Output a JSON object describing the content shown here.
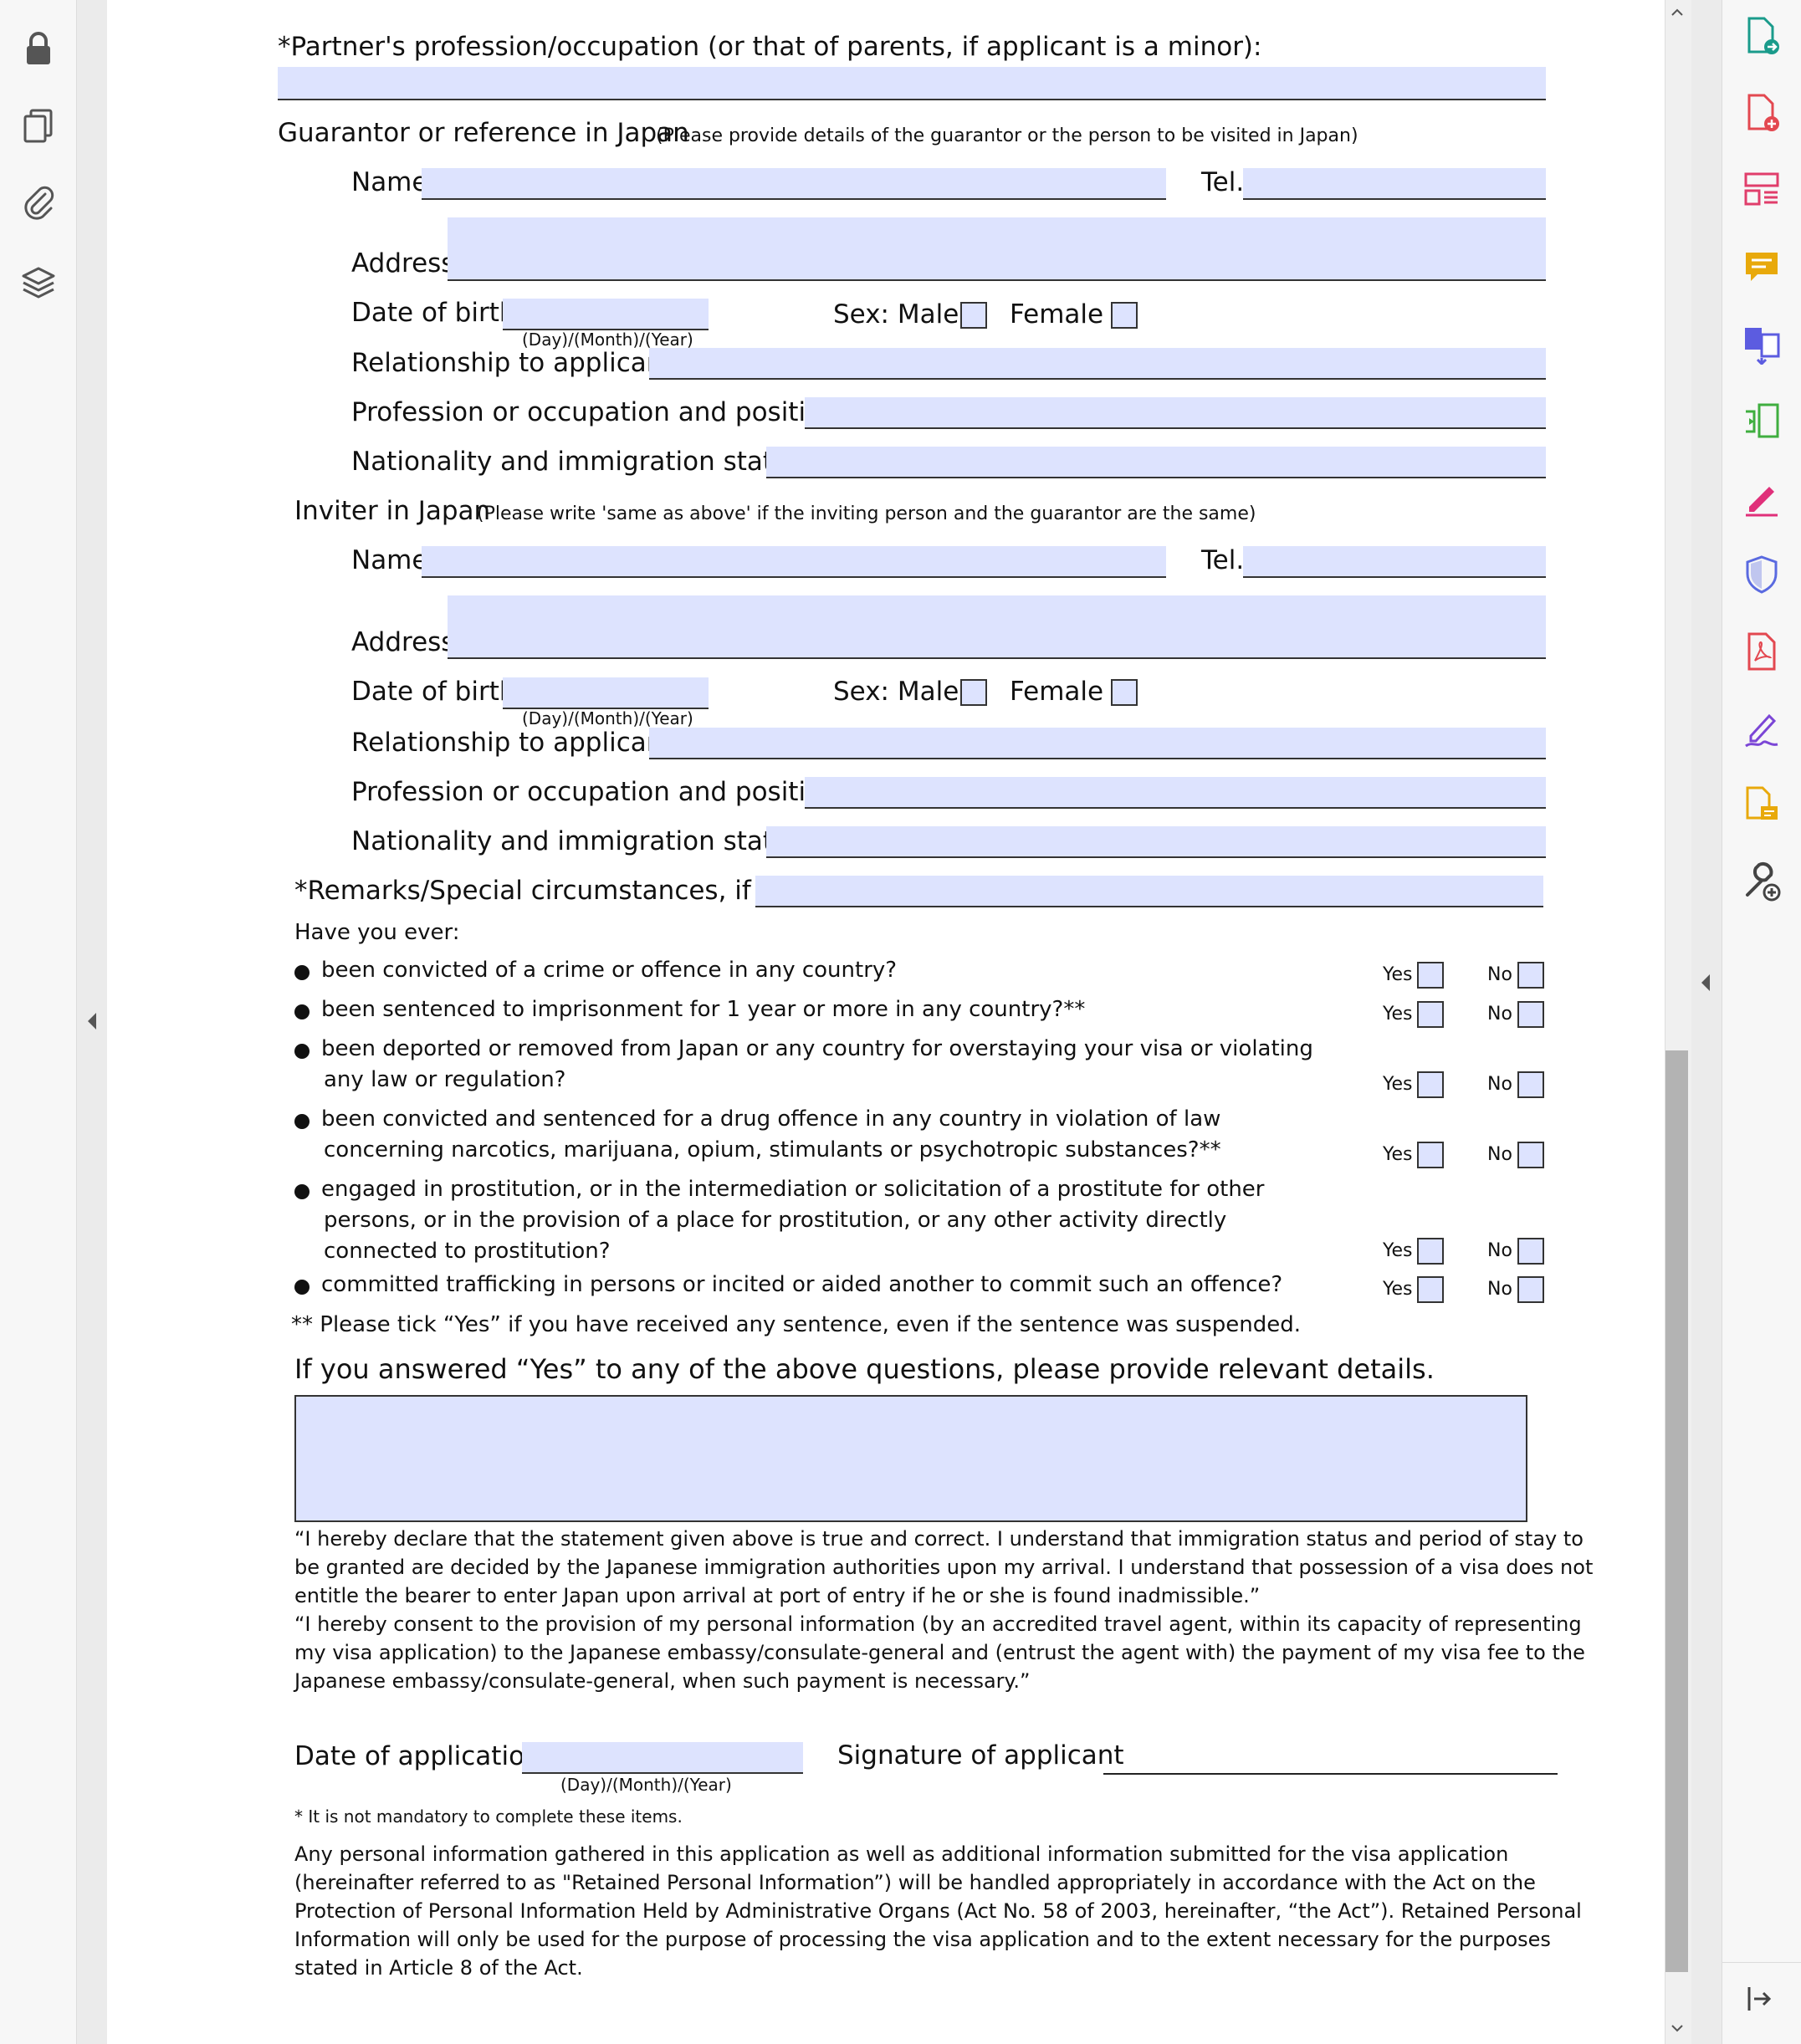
{
  "viewer": {
    "left_tools": [
      {
        "icon": "lock-icon"
      },
      {
        "icon": "pages-icon"
      },
      {
        "icon": "attachment-icon"
      },
      {
        "icon": "layers-icon"
      }
    ],
    "right_tools": [
      {
        "icon": "export-pdf-icon",
        "color": "#1a9b8b"
      },
      {
        "icon": "create-pdf-icon",
        "color": "#e34850"
      },
      {
        "icon": "organize-pages-icon",
        "color": "#e03e6b"
      },
      {
        "icon": "comment-icon",
        "color": "#e8a90b"
      },
      {
        "icon": "combine-files-icon",
        "color": "#5c5ce0"
      },
      {
        "icon": "compress-pdf-icon",
        "color": "#3fae3f"
      },
      {
        "icon": "fill-sign-icon",
        "color": "#e0307a"
      },
      {
        "icon": "protect-icon",
        "color": "#5a6ae0"
      },
      {
        "icon": "acrobat-pdf-icon",
        "color": "#e34850"
      },
      {
        "icon": "request-signature-icon",
        "color": "#7b46d6"
      },
      {
        "icon": "review-document-icon",
        "color": "#e8a90b"
      },
      {
        "icon": "more-tools-icon",
        "color": "#444444"
      }
    ]
  },
  "form": {
    "partner_occupation_label": "*Partner's profession/occupation (or that of parents, if applicant is a minor):",
    "guarantor": {
      "heading": "Guarantor or reference in Japan",
      "note": "(Please provide details of the guarantor or the person to be visited in Japan)",
      "name_label": "Name",
      "tel_label": "Tel.",
      "address_label": "Address",
      "dob_label": "Date of birth",
      "dob_format": "(Day)/(Month)/(Year)",
      "sex_label": "Sex: Male",
      "female_label": "Female",
      "relationship_label": "Relationship to applicant",
      "profession_label": "Profession or occupation and position",
      "nationality_label": "Nationality and immigration status"
    },
    "inviter": {
      "heading": "Inviter in Japan",
      "note": "(Please write 'same as above' if the inviting person and the guarantor are the same)",
      "name_label": "Name",
      "tel_label": "Tel.",
      "address_label": "Address",
      "dob_label": "Date of birth",
      "dob_format": "(Day)/(Month)/(Year)",
      "sex_label": "Sex: Male",
      "female_label": "Female",
      "relationship_label": "Relationship to applicant",
      "profession_label": "Profession or occupation and position",
      "nationality_label": "Nationality and immigration status"
    },
    "remarks_label": "*Remarks/Special circumstances, if any",
    "have_you_ever": "Have you ever:",
    "yes_label": "Yes",
    "no_label": "No",
    "questions": [
      {
        "lines": [
          "been convicted of a crime or offence in any country?"
        ]
      },
      {
        "lines": [
          "been sentenced to imprisonment for 1 year or more in any country?**"
        ]
      },
      {
        "lines": [
          "been deported or removed from Japan or any country for overstaying your visa or violating",
          "any law or regulation?"
        ]
      },
      {
        "lines": [
          "been convicted and sentenced for a drug offence in any country in violation of law",
          "concerning narcotics, marijuana, opium, stimulants or psychotropic substances?**"
        ]
      },
      {
        "lines": [
          "engaged in prostitution, or in the intermediation or solicitation of a prostitute for other",
          "persons, or in the provision of a place for prostitution, or any other activity directly",
          "connected to prostitution?"
        ]
      },
      {
        "lines": [
          "committed trafficking in persons or incited or aided another to commit such an offence?"
        ]
      }
    ],
    "suspended_note": "** Please tick “Yes” if you have received any sentence, even if the sentence was suspended.",
    "details_prompt": "If you answered “Yes” to any of the above questions, please provide relevant details.",
    "declaration": [
      "“I hereby declare that the statement given above is true and correct. I understand that immigration status and period of stay to",
      "be granted  are decided by the Japanese immigration authorities upon my arrival. I understand that possession of a visa does not",
      "entitle the bearer to  enter Japan upon arrival at port of entry if he or she is found inadmissible.”",
      "“I hereby consent to the provision of my personal information (by an accredited travel agent, within its capacity of representing",
      "my visa application) to the Japanese embassy/consulate-general and (entrust the agent with) the payment of my visa fee to the",
      "Japanese embassy/consulate-general, when such payment is necessary.”"
    ],
    "date_of_application_label": "Date of application",
    "date_format": "(Day)/(Month)/(Year)",
    "signature_label": "Signature of applicant",
    "not_mandatory_note": "* It is not mandatory to complete these items.",
    "privacy": [
      "Any personal information gathered in this application as well as additional information submitted for the visa application",
      "(hereinafter referred to as  \"Retained Personal Information”) will be handled appropriately in accordance with the Act on the",
      "Protection of Personal Information Held by Administrative Organs (Act No. 58 of 2003, hereinafter, “the Act”). Retained Personal",
      "Information will only be used for the  purpose of processing the visa application and to the extent necessary for the purposes",
      "stated in Article 8 of the Act."
    ]
  }
}
